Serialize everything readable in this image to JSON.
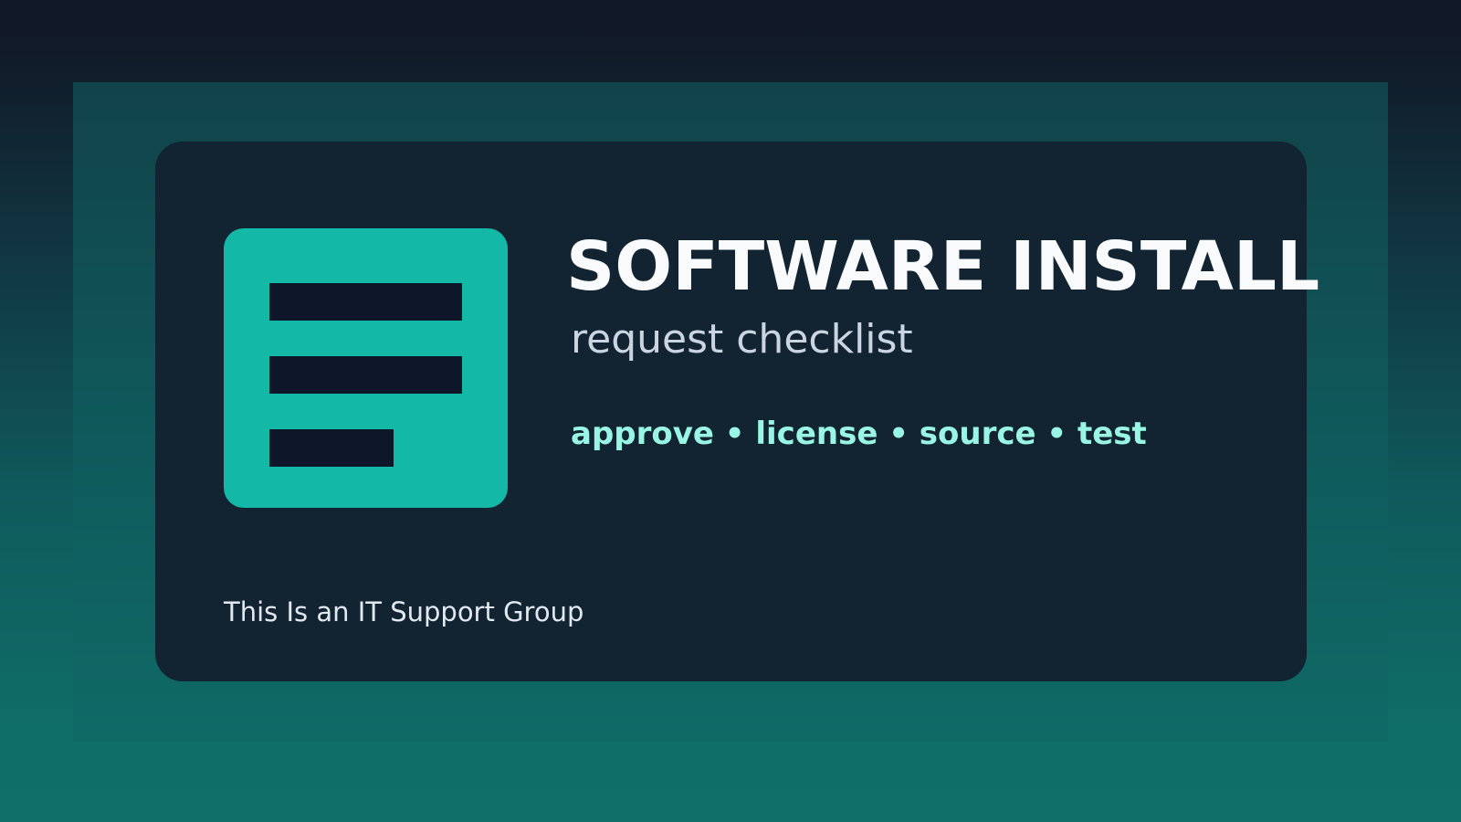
{
  "colors": {
    "background_top": "#111827",
    "background_bottom": "#0f6f69",
    "card": "#122431",
    "icon_accent": "#13b8a6",
    "icon_lines": "#0e1729",
    "title": "#f8fafc",
    "subtitle": "#cbd5e1",
    "tags": "#99f6e4",
    "footer": "#e2e8f0"
  },
  "icon": "document-lines-icon",
  "title": "SOFTWARE INSTALL",
  "subtitle": "request checklist",
  "tags": "approve • license • source • test",
  "footer": "This Is an IT Support Group"
}
